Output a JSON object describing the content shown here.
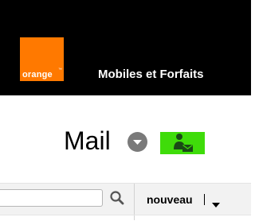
{
  "header": {
    "logo_text": "orange",
    "logo_tm": "™",
    "nav_link": "Mobiles et Forfaits",
    "brand_color": "#ff7900"
  },
  "main": {
    "title": "Mail",
    "title_dropdown_icon": "chevron-down-circle-icon",
    "contact_button_icon": "contact-mail-icon",
    "contact_button_color": "#3fdc0a"
  },
  "toolbar": {
    "search_value": "",
    "search_icon": "search-icon",
    "new_label": "nouveau",
    "new_dropdown_icon": "caret-down-icon"
  }
}
